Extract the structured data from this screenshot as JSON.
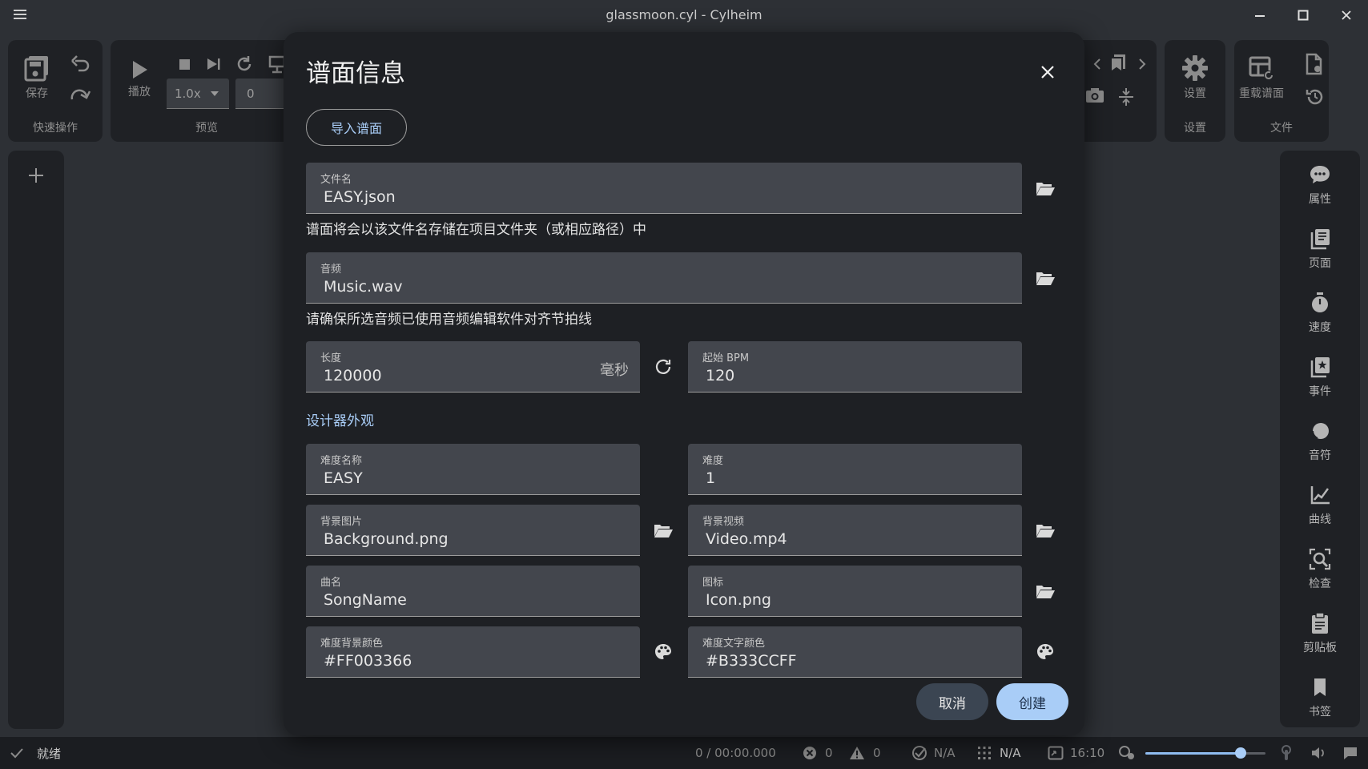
{
  "window": {
    "title": "glassmoon.cyl - Cylheim"
  },
  "toolbar": {
    "quick": {
      "save_label": "保存",
      "group_label": "快速操作"
    },
    "preview": {
      "play_label": "播放",
      "speed_value": "1.0x",
      "position_value": "0",
      "group_label": "预览"
    },
    "settings": {
      "settings_label": "设置",
      "group_label": "设置"
    },
    "file": {
      "reload_label": "重载谱面",
      "group_label": "文件"
    }
  },
  "right_panel": {
    "items": [
      {
        "label": "属性",
        "icon": "comment-dots-icon"
      },
      {
        "label": "页面",
        "icon": "pages-icon"
      },
      {
        "label": "速度",
        "icon": "stopwatch-icon"
      },
      {
        "label": "事件",
        "icon": "event-icon"
      },
      {
        "label": "音符",
        "icon": "note-circle-icon"
      },
      {
        "label": "曲线",
        "icon": "curve-chart-icon"
      },
      {
        "label": "检查",
        "icon": "inspect-icon"
      },
      {
        "label": "剪贴板",
        "icon": "clipboard-icon"
      },
      {
        "label": "书签",
        "icon": "bookmark-icon"
      }
    ]
  },
  "status": {
    "state_text": "就绪",
    "time_text": "0 / 00:00.000",
    "errors": "0",
    "warnings": "0",
    "check_value": "N/A",
    "grid_value": "N/A",
    "aspect_value": "16:10",
    "zoom_level": 0.79
  },
  "dialog": {
    "title": "谱面信息",
    "import_button": "导入谱面",
    "filename": {
      "label": "文件名",
      "value": "EASY.json",
      "helper": "谱面将会以该文件名存储在项目文件夹（或相应路径）中"
    },
    "audio": {
      "label": "音频",
      "value": "Music.wav",
      "helper": "请确保所选音频已使用音频编辑软件对齐节拍线"
    },
    "length": {
      "label": "长度",
      "value": "120000",
      "unit": "毫秒"
    },
    "start_bpm": {
      "label": "起始 BPM",
      "value": "120"
    },
    "section_appearance": "设计器外观",
    "difficulty_name": {
      "label": "难度名称",
      "value": "EASY"
    },
    "difficulty": {
      "label": "难度",
      "value": "1"
    },
    "bg_image": {
      "label": "背景图片",
      "value": "Background.png"
    },
    "bg_video": {
      "label": "背景视频",
      "value": "Video.mp4"
    },
    "song_name": {
      "label": "曲名",
      "value": "SongName"
    },
    "icon_file": {
      "label": "图标",
      "value": "Icon.png"
    },
    "diff_bg_color": {
      "label": "难度背景颜色",
      "value": "#FF003366"
    },
    "diff_text_color": {
      "label": "难度文字颜色",
      "value": "#B333CCFF"
    },
    "cancel_button": "取消",
    "create_button": "创建"
  },
  "colors": {
    "accent": "#a9cdf7",
    "dialog_bg": "#1e2024",
    "field_bg": "#43464d",
    "app_bg": "#2d3035"
  }
}
